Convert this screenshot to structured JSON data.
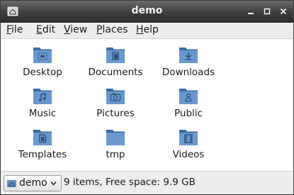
{
  "window": {
    "title": "demo"
  },
  "menu": [
    {
      "mnemonic": "F",
      "rest": "ile"
    },
    {
      "mnemonic": "E",
      "rest": "dit"
    },
    {
      "mnemonic": "V",
      "rest": "iew"
    },
    {
      "mnemonic": "P",
      "rest": "laces"
    },
    {
      "mnemonic": "H",
      "rest": "elp"
    }
  ],
  "items": [
    {
      "label": "Desktop",
      "icon": "desktop-folder-icon"
    },
    {
      "label": "Documents",
      "icon": "documents-folder-icon"
    },
    {
      "label": "Downloads",
      "icon": "downloads-folder-icon"
    },
    {
      "label": "Music",
      "icon": "music-folder-icon"
    },
    {
      "label": "Pictures",
      "icon": "pictures-folder-icon"
    },
    {
      "label": "Public",
      "icon": "public-folder-icon"
    },
    {
      "label": "Templates",
      "icon": "templates-folder-icon"
    },
    {
      "label": "tmp",
      "icon": "folder-icon"
    },
    {
      "label": "Videos",
      "icon": "videos-folder-icon"
    }
  ],
  "statusbar": {
    "location": "demo",
    "summary": "9 items, Free space: 9.9 GB"
  },
  "colors": {
    "folder": "#5f8fc6",
    "folder_dark": "#3c6aa3",
    "titlebar": "#3e3e3e"
  }
}
